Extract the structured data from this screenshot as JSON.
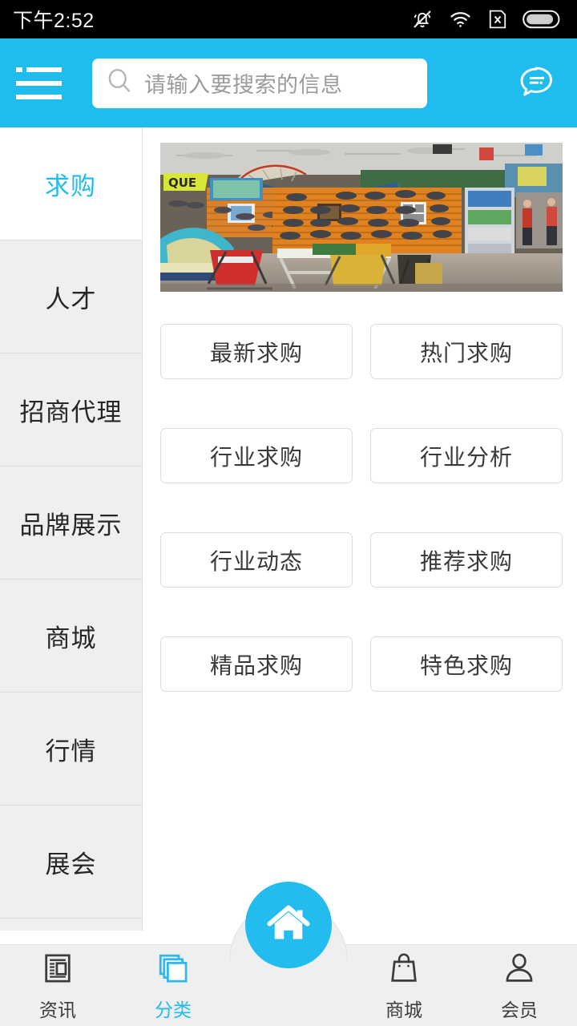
{
  "status_bar": {
    "time": "下午2:52",
    "icons": [
      "mute-bell-icon",
      "wifi-icon",
      "sim-x-icon",
      "battery-icon"
    ]
  },
  "header": {
    "menu_icon": "hamburger-menu-icon",
    "chat_icon": "chat-bubble-icon",
    "accent_color": "#1fbcef",
    "search": {
      "icon": "search-icon",
      "placeholder": "请输入要搜索的信息",
      "value": ""
    }
  },
  "sidebar": {
    "items": [
      {
        "label": "求购",
        "active": true
      },
      {
        "label": "人才",
        "active": false
      },
      {
        "label": "招商代理",
        "active": false
      },
      {
        "label": "品牌展示",
        "active": false
      },
      {
        "label": "商城",
        "active": false
      },
      {
        "label": "行情",
        "active": false
      },
      {
        "label": "展会",
        "active": false
      }
    ]
  },
  "main": {
    "banner": {
      "alt": "户外用品商店展示图"
    },
    "tiles": [
      {
        "label": "最新求购"
      },
      {
        "label": "热门求购"
      },
      {
        "label": "行业求购"
      },
      {
        "label": "行业分析"
      },
      {
        "label": "行业动态"
      },
      {
        "label": "推荐求购"
      },
      {
        "label": "精品求购"
      },
      {
        "label": "特色求购"
      }
    ]
  },
  "bottom_nav": {
    "active_color": "#21bbee",
    "items": [
      {
        "label": "资讯",
        "icon": "news-icon",
        "active": false
      },
      {
        "label": "分类",
        "icon": "categories-icon",
        "active": true
      },
      {
        "label": "商城",
        "icon": "shopping-bag-icon",
        "active": false
      },
      {
        "label": "会员",
        "icon": "user-icon",
        "active": false
      }
    ],
    "home_button": {
      "icon": "home-icon",
      "label": ""
    }
  }
}
